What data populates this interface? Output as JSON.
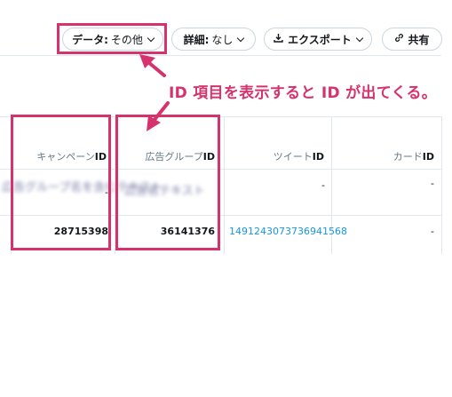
{
  "toolbar": {
    "data_label": "データ:",
    "data_value": "その他",
    "detail_label": "詳細:",
    "detail_value": "なし",
    "export_label": "エクスポート",
    "share_label": "共有"
  },
  "annotation": {
    "text": "ID 項目を表示すると ID が出てくる。",
    "color": "#d6336c"
  },
  "table": {
    "columns": [
      {
        "prefix": "キャンペーン",
        "suffix": "ID"
      },
      {
        "prefix": "広告グループ",
        "suffix": "ID"
      },
      {
        "prefix": "ツイート",
        "suffix": "ID"
      },
      {
        "prefix": "カード",
        "suffix": "ID"
      }
    ],
    "rows": [
      {
        "campaign_id": "-",
        "ad_group_id": "",
        "tweet_id": "-",
        "card_id": "-"
      },
      {
        "campaign_id": "28715398",
        "ad_group_id": "36141376",
        "tweet_id": "1491243073736941568",
        "card_id": "-"
      }
    ]
  },
  "overlay": {
    "blurred_text_left": "広告グループ名を含むテキスト",
    "blurred_text_right": "広告名テキスト"
  },
  "icons": [
    "chevron-down-icon",
    "download-icon",
    "link-icon"
  ]
}
